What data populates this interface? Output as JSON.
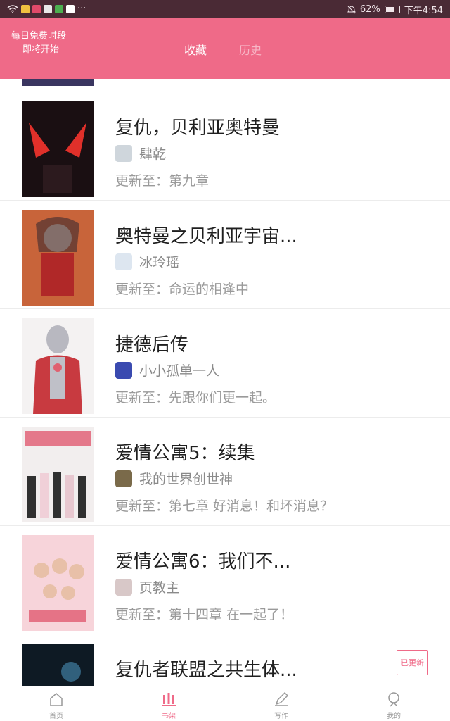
{
  "status_bar": {
    "battery": "62%",
    "time": "下午4:54",
    "more": "···",
    "battery_level": 0.62
  },
  "header": {
    "free_line1": "每日免费时段",
    "free_line2": "即将开始",
    "tab_favorites": "收藏",
    "tab_history": "历史"
  },
  "books": [
    {
      "title": "复仇，贝利亚奥特曼",
      "author": "肆乾",
      "update": "更新至：第九章"
    },
    {
      "title": "奥特曼之贝利亚宇宙...",
      "author": "冰玲瑶",
      "update": "更新至：命运的相逢中"
    },
    {
      "title": "捷德后传",
      "author": "小小孤单一人",
      "update": "更新至：先跟你们更一起。"
    },
    {
      "title": "爱情公寓5：续集",
      "author": "我的世界创世神",
      "update": "更新至：第七章  好消息！和坏消息？"
    },
    {
      "title": "爱情公寓6：我们不...",
      "author": "页教主",
      "update": "更新至：第十四章  在一起了！"
    },
    {
      "title": "复仇者联盟之共生体...",
      "author": "",
      "update": "",
      "badge": "已更新"
    }
  ],
  "bottom_nav": {
    "home": "首页",
    "shelf": "书架",
    "write": "写作",
    "me": "我的"
  },
  "colors": {
    "accent": "#ef6a88",
    "status_bar": "#4a2a35"
  }
}
